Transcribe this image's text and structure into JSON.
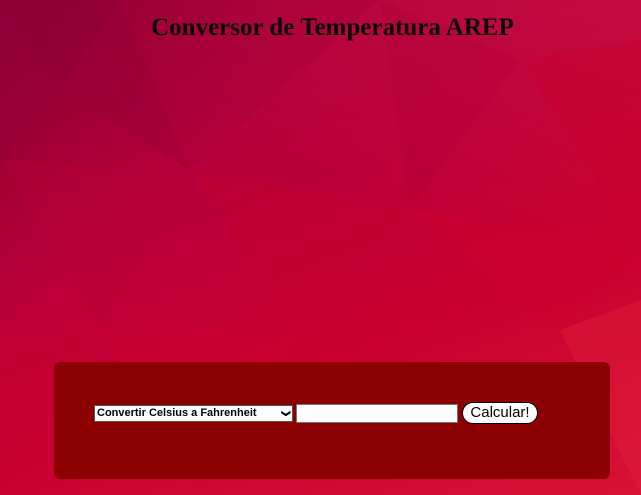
{
  "header": {
    "title": "Conversor de Temperatura AREP"
  },
  "converter": {
    "select_value": "Convertir Celsius a Fahrenheit",
    "input_value": "",
    "button_label": "Calcular!"
  },
  "colors": {
    "panel": "#8b0000",
    "background_primary": "#c9002f",
    "background_dark": "#a3003b"
  },
  "icons": {
    "select_arrow": "chevron-down-icon"
  }
}
